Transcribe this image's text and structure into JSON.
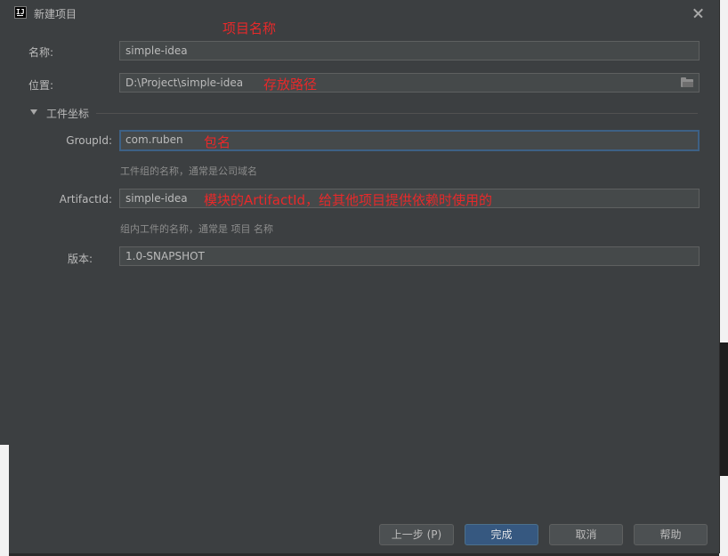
{
  "window": {
    "title": "新建项目",
    "icon": "intellij-idea-icon"
  },
  "annotations": {
    "name_note": "项目名称",
    "location_note": "存放路径",
    "group_note": "包名",
    "artifact_note": "模块的ArtifactId，给其他项目提供依赖时使用的"
  },
  "form": {
    "name": {
      "label": "名称:",
      "value": "simple-idea"
    },
    "location": {
      "label": "位置:",
      "value": "D:\\Project\\simple-idea",
      "browse_icon": "folder-icon"
    },
    "artifact_coordinates": {
      "title": "工件坐标",
      "group_id": {
        "label": "GroupId:",
        "value": "com.ruben",
        "hint": "工件组的名称，通常是公司域名"
      },
      "artifact_id": {
        "label": "ArtifactId:",
        "value": "simple-idea",
        "hint": "组内工件的名称，通常是 项目 名称"
      },
      "version": {
        "label": "版本:",
        "value": "1.0-SNAPSHOT"
      }
    }
  },
  "buttons": {
    "previous": "上一步 (P)",
    "finish": "完成",
    "cancel": "取消",
    "help": "帮助"
  },
  "colors": {
    "dialog_bg": "#3c3f41",
    "field_bg": "#45494a",
    "annotation_red": "#e8292a",
    "primary_button": "#365880",
    "focus_border": "#3d6185"
  }
}
